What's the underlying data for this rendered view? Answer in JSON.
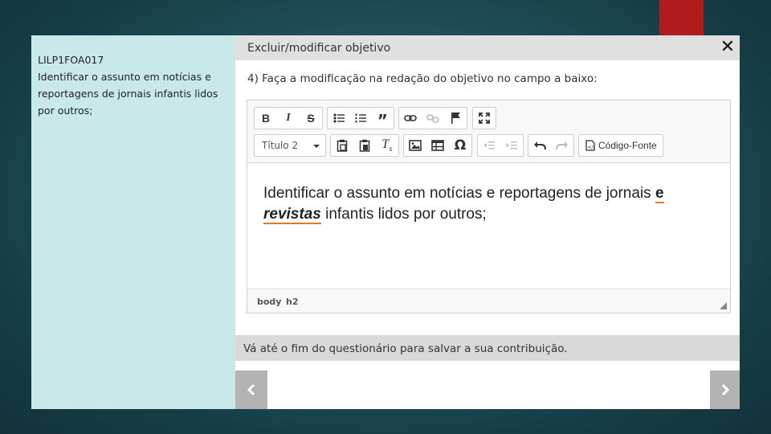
{
  "left_panel": {
    "code": "LILP1FOA017",
    "description": "Identificar o assunto em notícias e reportagens de jornais infantis lidos por outros;"
  },
  "dialog": {
    "title": "Excluir/modificar objetivo",
    "close_glyph": "✕",
    "instruction": "4) Faça a modificação na redação do objetivo no campo a baixo:"
  },
  "toolbar": {
    "format_select_value": "Título 2",
    "source_label": "Código-Fonte",
    "icons": [
      "bold-icon",
      "italic-icon",
      "strike-icon",
      "bulleted-list-icon",
      "numbered-list-icon",
      "blockquote-icon",
      "link-icon",
      "unlink-icon",
      "anchor-icon",
      "maximize-icon",
      "paste-icon",
      "paste-word-icon",
      "remove-format-icon",
      "image-icon",
      "table-icon",
      "special-char-icon",
      "outdent-icon",
      "indent-icon",
      "undo-icon",
      "redo-icon",
      "source-icon"
    ]
  },
  "editor": {
    "text_before": "Identificar o assunto em notícias e reportagens de jornais ",
    "flag_1": "e",
    "flag_2": "revistas",
    "text_after": " infantis lidos por outros;"
  },
  "pathbar": {
    "item_1": "body",
    "item_2": "h2"
  },
  "footer": {
    "note": "Vá até o fim do questionário para salvar a sua contribuição."
  },
  "nav": {
    "prev_glyph": "‹",
    "next_glyph": "›"
  },
  "colors": {
    "left_panel_bg": "#c9e8ea",
    "header_bg": "#e0e0e0",
    "spell_underline": "#e07b2a",
    "accent_red": "#b01c1c"
  }
}
